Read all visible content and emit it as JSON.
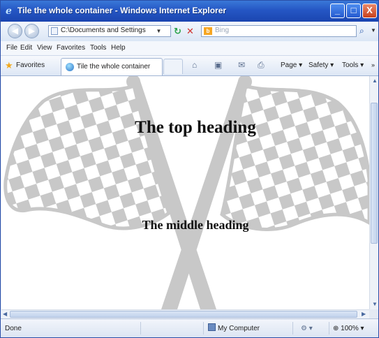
{
  "window": {
    "title": "Tile the whole container - Windows Internet Explorer",
    "minimize": "_",
    "maximize": "□",
    "close": "X"
  },
  "address_bar": {
    "url": "C:\\Documents and Settings",
    "search_placeholder": "Bing"
  },
  "menu": {
    "items": [
      "File",
      "Edit",
      "View",
      "Favorites",
      "Tools",
      "Help"
    ]
  },
  "favorites_bar": {
    "favorites_label": "Favorites",
    "tab_title": "Tile the whole container",
    "commands": [
      "Page",
      "Safety",
      "Tools"
    ]
  },
  "content": {
    "top_heading": "The top heading",
    "middle_heading": "The middle heading"
  },
  "status_bar": {
    "status": "Done",
    "zone": "My Computer",
    "zoom": "100%"
  },
  "colors": {
    "titlebar": "#2556c4",
    "flag_gray": "#c8c8c8",
    "chrome_bg": "#dfe9f7"
  }
}
